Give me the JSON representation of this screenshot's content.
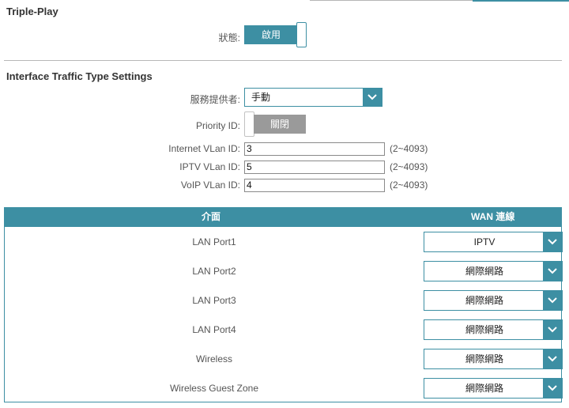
{
  "triple_play": {
    "title": "Triple-Play",
    "status_label": "狀態:",
    "status_value": "啟用"
  },
  "interface_settings": {
    "title": "Interface Traffic Type Settings",
    "provider_label": "服務提供者:",
    "provider_value": "手動",
    "priority_label": "Priority ID:",
    "priority_value": "關閉",
    "fields": [
      {
        "label": "Internet VLan ID:",
        "value": "3",
        "range": "(2~4093)"
      },
      {
        "label": "IPTV VLan ID:",
        "value": "5",
        "range": "(2~4093)"
      },
      {
        "label": "VoIP VLan ID:",
        "value": "4",
        "range": "(2~4093)"
      }
    ]
  },
  "table": {
    "header_interface": "介面",
    "header_wan": "WAN 連線",
    "rows": [
      {
        "interface": "LAN Port1",
        "wan": "IPTV"
      },
      {
        "interface": "LAN Port2",
        "wan": "網際網路"
      },
      {
        "interface": "LAN Port3",
        "wan": "網際網路"
      },
      {
        "interface": "LAN Port4",
        "wan": "網際網路"
      },
      {
        "interface": "Wireless",
        "wan": "網際網路"
      },
      {
        "interface": "Wireless Guest Zone",
        "wan": "網際網路"
      }
    ]
  },
  "colors": {
    "accent": "#3d8fa3",
    "toggle_off": "#9a9a9a"
  },
  "icons": {
    "dropdown": "chevron-down-icon"
  }
}
